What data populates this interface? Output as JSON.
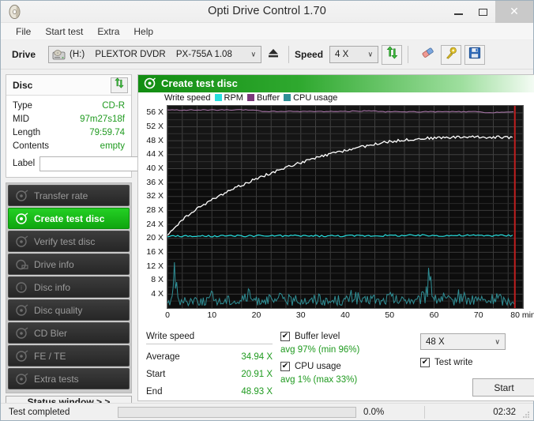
{
  "window": {
    "title": "Opti Drive Control 1.70",
    "icon": "disc-icon",
    "minimize": "minimize-icon",
    "maximize": "maximize-icon",
    "close": "close-icon"
  },
  "menu": {
    "items": [
      "File",
      "Start test",
      "Extra",
      "Help"
    ]
  },
  "toolbar": {
    "drive_label": "Drive",
    "drive_letter": "(H:)",
    "drive_vendor": "PLEXTOR DVDR",
    "drive_model": "PX-755A 1.08",
    "eject_icon": "eject-icon",
    "speed_label": "Speed",
    "speed_value": "4 X",
    "refresh_icon": "refresh-icon",
    "eraser_icon": "eraser-icon",
    "tools_icon": "tools-icon",
    "save_icon": "save-icon"
  },
  "disc": {
    "title": "Disc",
    "refresh_icon": "refresh-icon",
    "rows": [
      {
        "key": "Type",
        "value": "CD-R"
      },
      {
        "key": "MID",
        "value": "97m27s18f"
      },
      {
        "key": "Length",
        "value": "79:59.74"
      },
      {
        "key": "Contents",
        "value": "empty"
      }
    ],
    "label_key": "Label",
    "label_value": "",
    "label_placeholder": "",
    "disc_button_icon": "cd-icon"
  },
  "sidebar": {
    "items": [
      {
        "label": "Transfer rate",
        "icon": "disc-scan-icon",
        "active": false
      },
      {
        "label": "Create test disc",
        "icon": "disc-write-icon",
        "active": true
      },
      {
        "label": "Verify test disc",
        "icon": "disc-scan-icon",
        "active": false
      },
      {
        "label": "Drive info",
        "icon": "drive-info-icon",
        "active": false
      },
      {
        "label": "Disc info",
        "icon": "disc-info-icon",
        "active": false
      },
      {
        "label": "Disc quality",
        "icon": "disc-scan-icon",
        "active": false
      },
      {
        "label": "CD Bler",
        "icon": "disc-scan-icon",
        "active": false
      },
      {
        "label": "FE / TE",
        "icon": "disc-scan-icon",
        "active": false
      },
      {
        "label": "Extra tests",
        "icon": "disc-scan-icon",
        "active": false
      }
    ],
    "status_window_button": "Status window > >"
  },
  "panel": {
    "title": "Create test disc",
    "icon": "disc-write-icon"
  },
  "chart_data": {
    "type": "line",
    "title": "Create test disc",
    "xlabel": "min",
    "ylabel": "X",
    "xlim": [
      0,
      80
    ],
    "ylim": [
      0,
      58
    ],
    "xticks": [
      0,
      10,
      20,
      30,
      40,
      50,
      60,
      70,
      80
    ],
    "xtick_labels": [
      "0",
      "10",
      "20",
      "30",
      "40",
      "50",
      "60",
      "70",
      "80 min"
    ],
    "yticks": [
      4,
      8,
      12,
      16,
      20,
      24,
      28,
      32,
      36,
      40,
      44,
      48,
      52,
      56
    ],
    "ytick_labels": [
      "4 X",
      "8 X",
      "12 X",
      "16 X",
      "20 X",
      "24 X",
      "28 X",
      "32 X",
      "36 X",
      "40 X",
      "44 X",
      "48 X",
      "52 X",
      "56 X"
    ],
    "grid": true,
    "legend_position": "top-left",
    "background": "#0d0d0d",
    "end_marker_x": 78,
    "end_marker_color": "#c01f1f",
    "series": [
      {
        "name": "Write speed",
        "color": "#ffffff",
        "points": [
          [
            0.0,
            20.9
          ],
          [
            1.0,
            22.3
          ],
          [
            2.0,
            23.6
          ],
          [
            3.0,
            24.8
          ],
          [
            4.0,
            25.9
          ],
          [
            5.0,
            26.9
          ],
          [
            6.0,
            27.8
          ],
          [
            7.0,
            28.7
          ],
          [
            8.0,
            29.5
          ],
          [
            9.0,
            30.3
          ],
          [
            10.0,
            31.0
          ],
          [
            12.0,
            32.4
          ],
          [
            14.0,
            33.7
          ],
          [
            16.0,
            34.9
          ],
          [
            18.0,
            36.0
          ],
          [
            20.0,
            37.1
          ],
          [
            22.0,
            38.1
          ],
          [
            24.0,
            39.1
          ],
          [
            26.0,
            40.0
          ],
          [
            28.0,
            40.9
          ],
          [
            30.0,
            41.7
          ],
          [
            32.0,
            42.5
          ],
          [
            34.0,
            43.2
          ],
          [
            36.0,
            43.9
          ],
          [
            38.0,
            44.6
          ],
          [
            40.0,
            45.2
          ],
          [
            42.0,
            45.8
          ],
          [
            44.0,
            46.3
          ],
          [
            46.0,
            46.8
          ],
          [
            48.0,
            47.3
          ],
          [
            50.0,
            47.7
          ],
          [
            52.0,
            48.0
          ],
          [
            54.0,
            48.3
          ],
          [
            56.0,
            48.5
          ],
          [
            58.0,
            48.7
          ],
          [
            60.0,
            48.8
          ],
          [
            64.0,
            49.0
          ],
          [
            68.0,
            49.1
          ],
          [
            72.0,
            49.0
          ],
          [
            76.0,
            49.0
          ],
          [
            78.0,
            48.9
          ]
        ]
      },
      {
        "name": "RPM",
        "color": "#27dede",
        "points": [
          [
            0.0,
            20.6
          ],
          [
            10.0,
            20.6
          ],
          [
            20.0,
            20.7
          ],
          [
            30.0,
            20.7
          ],
          [
            40.0,
            20.7
          ],
          [
            50.0,
            20.8
          ],
          [
            60.0,
            20.8
          ],
          [
            70.0,
            20.8
          ],
          [
            78.0,
            20.8
          ]
        ]
      },
      {
        "name": "Buffer",
        "color": "#b07ab0",
        "note": "plotted along the top of the plot area, near 100%",
        "points": [
          [
            0.0,
            56.8
          ],
          [
            20.0,
            56.8
          ],
          [
            22.0,
            56.3
          ],
          [
            24.0,
            56.4
          ],
          [
            40.0,
            56.4
          ],
          [
            46.0,
            56.6
          ],
          [
            48.0,
            56.3
          ],
          [
            70.0,
            56.3
          ],
          [
            72.0,
            55.9
          ],
          [
            74.0,
            56.2
          ],
          [
            78.0,
            56.2
          ]
        ]
      },
      {
        "name": "CPU usage",
        "color": "#2f8f96",
        "note": "noisy low trace near bottom of plot; spikes at ~2 min and ~59 min",
        "points": [
          [
            0.3,
            1.2
          ],
          [
            1.0,
            1.6
          ],
          [
            1.8,
            13.0
          ],
          [
            2.3,
            5.5
          ],
          [
            2.6,
            1.4
          ],
          [
            4.0,
            1.8
          ],
          [
            6.0,
            2.4
          ],
          [
            8.0,
            1.6
          ],
          [
            10.0,
            2.8
          ],
          [
            12.0,
            1.5
          ],
          [
            14.0,
            2.2
          ],
          [
            16.0,
            1.6
          ],
          [
            18.0,
            3.2
          ],
          [
            20.0,
            1.8
          ],
          [
            22.0,
            2.6
          ],
          [
            24.0,
            1.5
          ],
          [
            26.0,
            3.0
          ],
          [
            28.0,
            1.7
          ],
          [
            30.0,
            2.4
          ],
          [
            32.0,
            1.6
          ],
          [
            34.0,
            2.9
          ],
          [
            36.0,
            1.5
          ],
          [
            38.0,
            2.2
          ],
          [
            40.0,
            1.8
          ],
          [
            42.0,
            3.4
          ],
          [
            44.0,
            1.6
          ],
          [
            46.0,
            2.6
          ],
          [
            48.0,
            1.5
          ],
          [
            50.0,
            2.8
          ],
          [
            52.0,
            1.7
          ],
          [
            54.0,
            2.4
          ],
          [
            56.0,
            1.6
          ],
          [
            58.0,
            3.1
          ],
          [
            59.0,
            10.5
          ],
          [
            60.0,
            2.0
          ],
          [
            62.0,
            2.6
          ],
          [
            64.0,
            1.6
          ],
          [
            66.0,
            3.4
          ],
          [
            68.0,
            1.8
          ],
          [
            70.0,
            2.4
          ],
          [
            72.0,
            1.6
          ],
          [
            74.0,
            2.9
          ],
          [
            76.0,
            1.7
          ],
          [
            78.0,
            2.2
          ]
        ]
      }
    ],
    "legend": [
      {
        "label": "Write speed",
        "color": "#ffffff"
      },
      {
        "label": "RPM",
        "color": "#27dede"
      },
      {
        "label": "Buffer",
        "color": "#7a3a7a"
      },
      {
        "label": "CPU usage",
        "color": "#2f8f96"
      }
    ]
  },
  "stats": {
    "write_speed_header": "Write speed",
    "rows": [
      {
        "key": "Average",
        "value": "34.94 X"
      },
      {
        "key": "Start",
        "value": "20.91 X"
      },
      {
        "key": "End",
        "value": "48.93 X"
      }
    ],
    "buffer_level_label": "Buffer level",
    "buffer_level_checked": true,
    "buffer_level_value": "avg 97% (min 96%)",
    "cpu_usage_label": "CPU usage",
    "cpu_usage_checked": true,
    "cpu_usage_value": "avg 1% (max 33%)"
  },
  "controls": {
    "write_speed_value": "48 X",
    "test_write_label": "Test write",
    "test_write_checked": true,
    "start_button": "Start"
  },
  "statusbar": {
    "message": "Test completed",
    "progress_percent": "0.0%",
    "progress_value": 0,
    "elapsed": "02:32"
  }
}
